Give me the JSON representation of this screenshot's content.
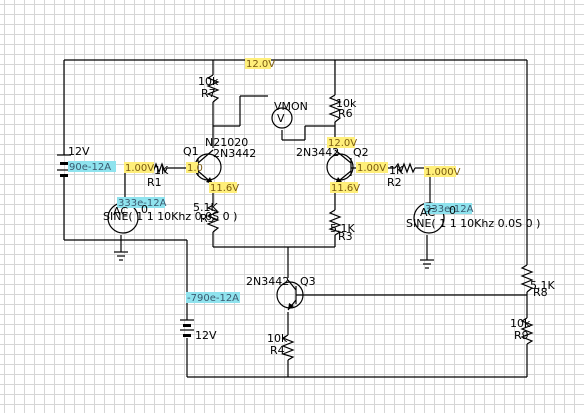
{
  "components": {
    "q1": {
      "name": "Q1",
      "model": "2N3442"
    },
    "q2": {
      "name": "Q2",
      "model": "2N3442"
    },
    "q3": {
      "name": "Q3",
      "model": "2N3442"
    },
    "r1": {
      "name": "R1",
      "value": "1K"
    },
    "r2": {
      "name": "R2",
      "value": "1K"
    },
    "r3": {
      "name": "R3",
      "value": "5.1K"
    },
    "r5": {
      "name": "R5",
      "value": "5.1K"
    },
    "r4": {
      "name": "R4",
      "value": "10k"
    },
    "r6": {
      "name": "R6",
      "value": "10k"
    },
    "r7": {
      "name": "R7",
      "value": "10k"
    },
    "r8": {
      "name": "R8",
      "value": "5.1K"
    },
    "r9": {
      "name": "R9",
      "value": "10k"
    },
    "v_top": {
      "value": "12V"
    },
    "v_bottom": {
      "value": "12V"
    },
    "vmon": {
      "name": "VMON",
      "symbol": "V"
    },
    "ac_left": {
      "label": "AC",
      "spec": "SINE( 1 1 10Khz 0.0S 0 )",
      "value": "0"
    },
    "ac_right": {
      "label": "AC",
      "spec": "SINE( 1 1 10Khz 0.0S 0 )",
      "value": "0"
    },
    "node_label": "N21020"
  },
  "probes": {
    "top_rail": "12.0V",
    "q2_collector": "12.0V",
    "q1_base": "1.00V",
    "q1_base_short": "1.0",
    "q2_base": "1.00V",
    "q2_base_right": "1.000V",
    "q1_emitter": "11.6V",
    "q2_emitter": "11.6V",
    "current_v12": "90e-12A",
    "current_ac_left": "333e-12A",
    "current_ac_right": "333e-12A",
    "current_q3": "-790e-12A"
  }
}
